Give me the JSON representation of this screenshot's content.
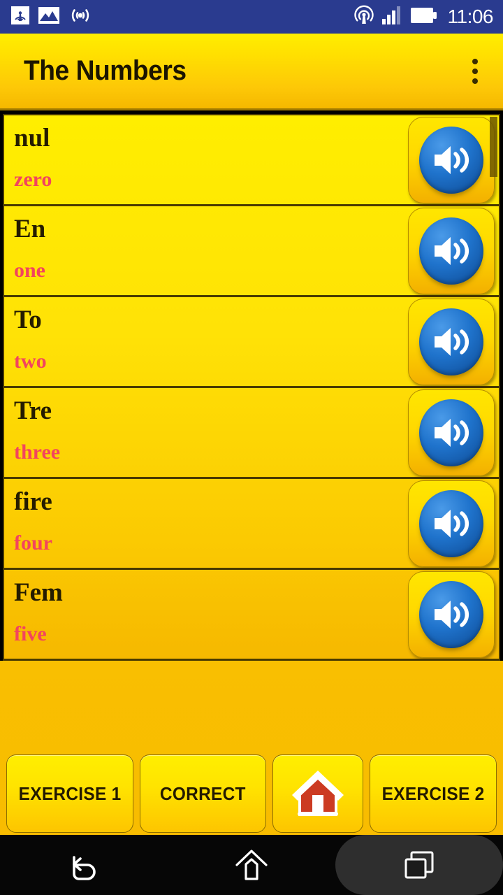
{
  "status_bar": {
    "time": "11:06",
    "background_color": "#2a3b8f",
    "left_icons": [
      {
        "name": "broadcast-antenna-icon",
        "label": "broadcast"
      },
      {
        "name": "image-photo-icon",
        "label": "photo"
      },
      {
        "name": "wifi-signal-icon",
        "label": "wifi"
      }
    ],
    "right_icons": [
      {
        "name": "hotspot-icon",
        "label": "hotspot"
      },
      {
        "name": "cellular-signal-icon",
        "label": "signal",
        "bars_filled": 3,
        "bars_total": 4
      },
      {
        "name": "battery-icon",
        "label": "battery",
        "level": "full"
      }
    ]
  },
  "title_bar": {
    "title": "The Numbers",
    "overflow_menu_label": "More options",
    "accent_top": "#ffee00",
    "accent_bottom": "#f5b800"
  },
  "list": {
    "scroll_position": "top",
    "rows": [
      {
        "native": "nul",
        "translation": "zero",
        "speaker_label": "Play nul"
      },
      {
        "native": "En",
        "translation": "one",
        "speaker_label": "Play En"
      },
      {
        "native": "To",
        "translation": "two",
        "speaker_label": "Play To"
      },
      {
        "native": "Tre",
        "translation": "three",
        "speaker_label": "Play Tre"
      },
      {
        "native": "fire",
        "translation": "four",
        "speaker_label": "Play fire"
      },
      {
        "native": "Fem",
        "translation": "five",
        "speaker_label": "Play Fem"
      }
    ],
    "native_color": "#251c00",
    "translation_color": "#f3445e"
  },
  "button_bar": {
    "buttons": [
      {
        "id": "exercise-1",
        "label": "EXERCISE 1",
        "type": "text"
      },
      {
        "id": "correct",
        "label": "CORRECT",
        "type": "text"
      },
      {
        "id": "home",
        "label": "Home",
        "type": "icon",
        "icon": "home-icon"
      },
      {
        "id": "exercise-2",
        "label": "EXERCISE 2",
        "type": "text"
      }
    ]
  },
  "nav_bar": {
    "items": [
      {
        "id": "back",
        "icon": "back-arrow-icon",
        "label": "Back"
      },
      {
        "id": "home",
        "icon": "home-outline-icon",
        "label": "Home"
      },
      {
        "id": "recents",
        "icon": "recents-icon",
        "label": "Recents",
        "highlighted": true
      }
    ]
  }
}
